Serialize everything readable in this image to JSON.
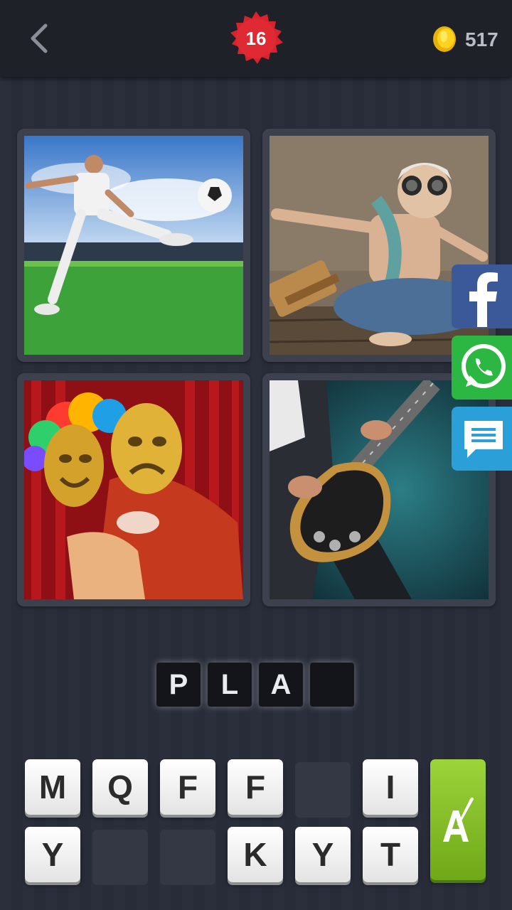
{
  "header": {
    "back_icon": "chevron-left-icon",
    "level": "16",
    "coins": "517",
    "coin_icon": "gold-coin-icon",
    "badge_color": "#d8232c"
  },
  "puzzle_images": [
    {
      "subject": "soccer player kicking ball"
    },
    {
      "subject": "child with aviator goggles and toy plane"
    },
    {
      "subject": "theater masks"
    },
    {
      "subject": "guitarist playing electric guitar"
    }
  ],
  "share_buttons": [
    {
      "icon": "facebook-icon",
      "color": "#3b5998"
    },
    {
      "icon": "whatsapp-icon",
      "color": "#2cb742"
    },
    {
      "icon": "message-icon",
      "color": "#2a9fd8"
    }
  ],
  "answer_slots": [
    "P",
    "L",
    "A",
    ""
  ],
  "letter_keys": {
    "row1": [
      "M",
      "Q",
      "F",
      "F",
      "",
      "I"
    ],
    "row2": [
      "Y",
      "",
      "",
      "K",
      "Y",
      "T"
    ]
  },
  "hint_button": {
    "icon": "paint-brush-hint-icon",
    "color": "#7fbf20"
  }
}
